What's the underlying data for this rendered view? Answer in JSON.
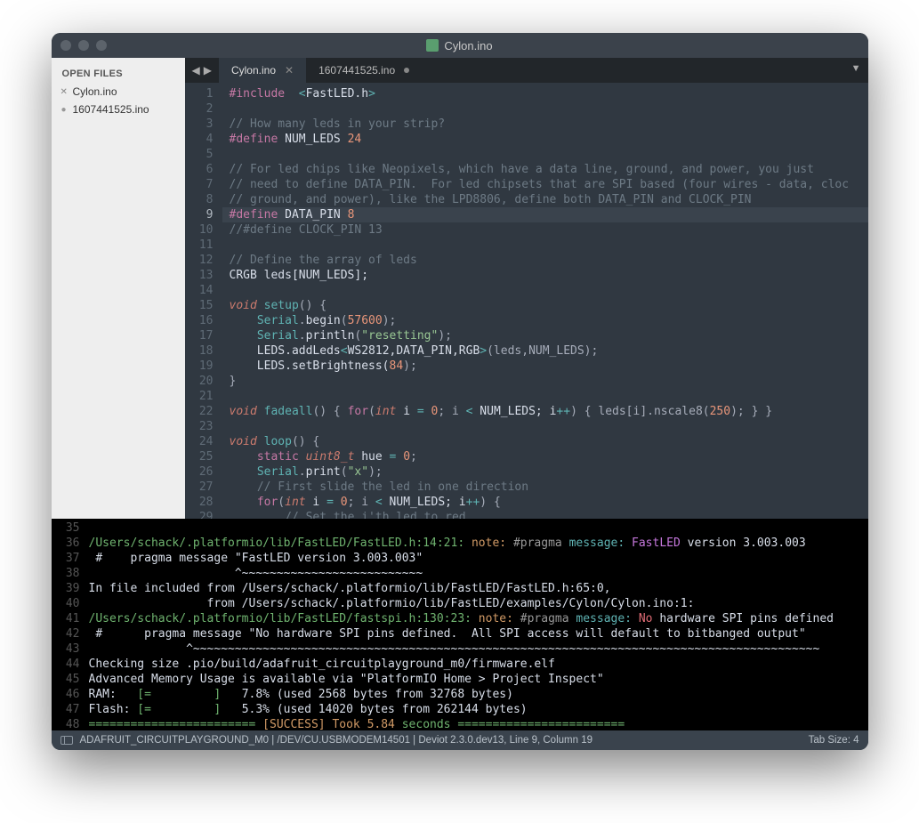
{
  "window": {
    "title": "Cylon.ino"
  },
  "sidebar": {
    "header": "OPEN FILES",
    "files": [
      {
        "name": "Cylon.ino",
        "dirty": false
      },
      {
        "name": "1607441525.ino",
        "dirty": true
      }
    ]
  },
  "tabs": {
    "items": [
      {
        "label": "Cylon.ino",
        "active": true,
        "dirty": false
      },
      {
        "label": "1607441525.ino",
        "active": false,
        "dirty": true
      }
    ]
  },
  "editor": {
    "highlight_line": 9,
    "line_start": 1,
    "lines": [
      [
        [
          "kw",
          "#include"
        ],
        [
          "id",
          "  "
        ],
        [
          "op",
          "<"
        ],
        [
          "id",
          "FastLED.h"
        ],
        [
          "op",
          ">"
        ]
      ],
      [],
      [
        [
          "cmt",
          "// How many leds in your strip?"
        ]
      ],
      [
        [
          "kw",
          "#define"
        ],
        [
          "id",
          " "
        ],
        [
          "macro",
          "NUM_LEDS"
        ],
        [
          "id",
          " "
        ],
        [
          "num",
          "24"
        ]
      ],
      [],
      [
        [
          "cmt",
          "// For led chips like Neopixels, which have a data line, ground, and power, you just"
        ]
      ],
      [
        [
          "cmt",
          "// need to define DATA_PIN.  For led chipsets that are SPI based (four wires - data, cloc"
        ]
      ],
      [
        [
          "cmt",
          "// ground, and power), like the LPD8806, define both DATA_PIN and CLOCK_PIN"
        ]
      ],
      [
        [
          "kw",
          "#define"
        ],
        [
          "id",
          " "
        ],
        [
          "macro",
          "DATA_PIN"
        ],
        [
          "id",
          " "
        ],
        [
          "num",
          "8"
        ]
      ],
      [
        [
          "cmt",
          "//#define CLOCK_PIN 13"
        ]
      ],
      [],
      [
        [
          "cmt",
          "// Define the array of leds"
        ]
      ],
      [
        [
          "id",
          "CRGB leds[NUM_LEDS];"
        ]
      ],
      [],
      [
        [
          "type",
          "void"
        ],
        [
          "id",
          " "
        ],
        [
          "func",
          "setup"
        ],
        [
          "punct",
          "() {"
        ]
      ],
      [
        [
          "id",
          "    "
        ],
        [
          "func",
          "Serial"
        ],
        [
          "punct",
          "."
        ],
        [
          "id",
          "begin"
        ],
        [
          "punct",
          "("
        ],
        [
          "num",
          "57600"
        ],
        [
          "punct",
          ");"
        ]
      ],
      [
        [
          "id",
          "    "
        ],
        [
          "func",
          "Serial"
        ],
        [
          "punct",
          "."
        ],
        [
          "id",
          "println"
        ],
        [
          "punct",
          "("
        ],
        [
          "str",
          "\"resetting\""
        ],
        [
          "punct",
          ");"
        ]
      ],
      [
        [
          "id",
          "    LEDS.addLeds"
        ],
        [
          "op",
          "<"
        ],
        [
          "id",
          "WS2812,DATA_PIN,RGB"
        ],
        [
          "op",
          ">"
        ],
        [
          "punct",
          "(leds,NUM_LEDS);"
        ]
      ],
      [
        [
          "id",
          "    LEDS.setBrightness("
        ],
        [
          "num",
          "84"
        ],
        [
          "punct",
          ");"
        ]
      ],
      [
        [
          "punct",
          "}"
        ]
      ],
      [],
      [
        [
          "type",
          "void"
        ],
        [
          "id",
          " "
        ],
        [
          "func",
          "fadeall"
        ],
        [
          "punct",
          "() { "
        ],
        [
          "kw",
          "for"
        ],
        [
          "punct",
          "("
        ],
        [
          "type",
          "int"
        ],
        [
          "id",
          " i "
        ],
        [
          "op",
          "="
        ],
        [
          "id",
          " "
        ],
        [
          "num",
          "0"
        ],
        [
          "punct",
          "; i "
        ],
        [
          "op",
          "<"
        ],
        [
          "id",
          " NUM_LEDS; i"
        ],
        [
          "op",
          "++"
        ],
        [
          "punct",
          ") { leds[i].nscale8("
        ],
        [
          "num",
          "250"
        ],
        [
          "punct",
          "); } }"
        ]
      ],
      [],
      [
        [
          "type",
          "void"
        ],
        [
          "id",
          " "
        ],
        [
          "func",
          "loop"
        ],
        [
          "punct",
          "() {"
        ]
      ],
      [
        [
          "id",
          "    "
        ],
        [
          "kw",
          "static"
        ],
        [
          "id",
          " "
        ],
        [
          "type",
          "uint8_t"
        ],
        [
          "id",
          " hue "
        ],
        [
          "op",
          "="
        ],
        [
          "id",
          " "
        ],
        [
          "num",
          "0"
        ],
        [
          "punct",
          ";"
        ]
      ],
      [
        [
          "id",
          "    "
        ],
        [
          "func",
          "Serial"
        ],
        [
          "punct",
          "."
        ],
        [
          "id",
          "print"
        ],
        [
          "punct",
          "("
        ],
        [
          "str",
          "\"x\""
        ],
        [
          "punct",
          ");"
        ]
      ],
      [
        [
          "id",
          "    "
        ],
        [
          "cmt",
          "// First slide the led in one direction"
        ]
      ],
      [
        [
          "id",
          "    "
        ],
        [
          "kw",
          "for"
        ],
        [
          "punct",
          "("
        ],
        [
          "type",
          "int"
        ],
        [
          "id",
          " i "
        ],
        [
          "op",
          "="
        ],
        [
          "id",
          " "
        ],
        [
          "num",
          "0"
        ],
        [
          "punct",
          "; i "
        ],
        [
          "op",
          "<"
        ],
        [
          "id",
          " NUM_LEDS; i"
        ],
        [
          "op",
          "++"
        ],
        [
          "punct",
          ") {"
        ]
      ],
      [
        [
          "id",
          "        "
        ],
        [
          "cmt",
          "// Set the i'th led to red"
        ]
      ]
    ]
  },
  "console": {
    "line_start": 35,
    "lines": [
      [
        [
          "id",
          ""
        ]
      ],
      [
        [
          "cpath",
          "/Users/schack/.platformio/lib/FastLED/FastLED.h:14:21:"
        ],
        [
          "id",
          " "
        ],
        [
          "cnote",
          "note:"
        ],
        [
          "id",
          " "
        ],
        [
          "cpragma",
          "#pragma"
        ],
        [
          "id",
          " "
        ],
        [
          "cmsg",
          "message:"
        ],
        [
          "id",
          " "
        ],
        [
          "cfast",
          "FastLED"
        ],
        [
          "id",
          " version 3.003.003"
        ]
      ],
      [
        [
          "id",
          " #    pragma message \"FastLED version 3.003.003\""
        ]
      ],
      [
        [
          "id",
          "                     ^~~~~~~~~~~~~~~~~~~~~~~~~~~"
        ]
      ],
      [
        [
          "id",
          "In file included from /Users/schack/.platformio/lib/FastLED/FastLED.h:65:0,"
        ]
      ],
      [
        [
          "id",
          "                 from /Users/schack/.platformio/lib/FastLED/examples/Cylon/Cylon.ino:1:"
        ]
      ],
      [
        [
          "cpath",
          "/Users/schack/.platformio/lib/FastLED/fastspi.h:130:23:"
        ],
        [
          "id",
          " "
        ],
        [
          "cnote",
          "note:"
        ],
        [
          "id",
          " "
        ],
        [
          "cpragma",
          "#pragma"
        ],
        [
          "id",
          " "
        ],
        [
          "cmsg",
          "message:"
        ],
        [
          "id",
          " "
        ],
        [
          "cno",
          "No"
        ],
        [
          "id",
          " hardware SPI pins defined"
        ]
      ],
      [
        [
          "id",
          " #      pragma message \"No hardware SPI pins defined.  All SPI access will default to bitbanged output\""
        ]
      ],
      [
        [
          "id",
          "              ^~~~~~~~~~~~~~~~~~~~~~~~~~~~~~~~~~~~~~~~~~~~~~~~~~~~~~~~~~~~~~~~~~~~~~~~~~~~~~~~~~~~~~~~~~~"
        ]
      ],
      [
        [
          "id",
          "Checking size .pio/build/adafruit_circuitplayground_m0/firmware.elf"
        ]
      ],
      [
        [
          "id",
          "Advanced Memory Usage is available via \"PlatformIO Home > Project Inspect\""
        ]
      ],
      [
        [
          "id",
          "RAM:   "
        ],
        [
          "cmark",
          "[=         ]"
        ],
        [
          "id",
          "   7.8% (used 2568 bytes from 32768 bytes)"
        ]
      ],
      [
        [
          "id",
          "Flash: "
        ],
        [
          "cmark",
          "[=         ]"
        ],
        [
          "id",
          "   5.3% (used 14020 bytes from 262144 bytes)"
        ]
      ],
      [
        [
          "csucc",
          "======================== "
        ],
        [
          "cyell",
          "[SUCCESS] Took 5.84"
        ],
        [
          "csucc",
          " seconds ========================"
        ]
      ]
    ]
  },
  "status": {
    "left": "ADAFRUIT_CIRCUITPLAYGROUND_M0 | /DEV/CU.USBMODEM14501 | Deviot 2.3.0.dev13, Line 9, Column 19",
    "right": "Tab Size: 4"
  }
}
